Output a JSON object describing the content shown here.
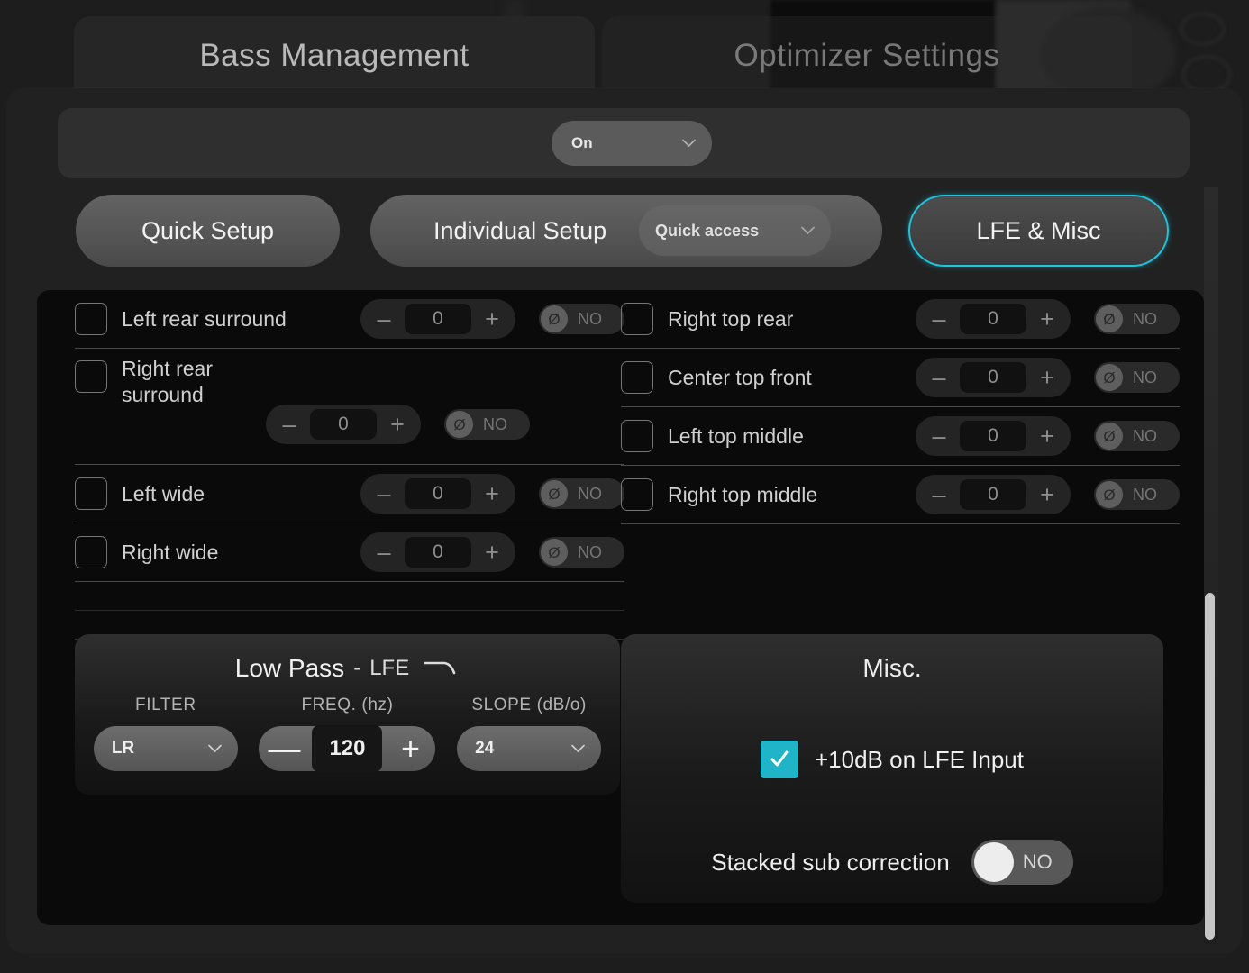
{
  "tabs": [
    {
      "label": "Bass Management",
      "active": true
    },
    {
      "label": "Optimizer Settings",
      "active": false
    }
  ],
  "power": {
    "value": "On",
    "icon": "chevron-down-icon"
  },
  "segments": [
    {
      "label": "Quick Setup",
      "active": false
    },
    {
      "label": "Individual Setup",
      "active": false
    },
    {
      "label": "LFE & Misc",
      "active": true
    }
  ],
  "quick_access": {
    "value": "Quick access",
    "icon": "chevron-down-icon"
  },
  "accent_color": "#21c3dd",
  "channels_left": [
    {
      "name": "Left rear surround",
      "checked": false,
      "level": "0",
      "phase": "NO",
      "wrapped": false
    },
    {
      "name": "Right rear surround",
      "checked": false,
      "level": "0",
      "phase": "NO",
      "wrapped": true
    },
    {
      "name": "Left wide",
      "checked": false,
      "level": "0",
      "phase": "NO",
      "wrapped": false
    },
    {
      "name": "Right wide",
      "checked": false,
      "level": "0",
      "phase": "NO",
      "wrapped": false
    }
  ],
  "channels_right": [
    {
      "name": "Right top rear",
      "checked": false,
      "level": "0",
      "phase": "NO",
      "wrapped": false
    },
    {
      "name": "Center top front",
      "checked": false,
      "level": "0",
      "phase": "NO",
      "wrapped": false
    },
    {
      "name": "Left top middle",
      "checked": false,
      "level": "0",
      "phase": "NO",
      "wrapped": false
    },
    {
      "name": "Right top middle",
      "checked": false,
      "level": "0",
      "phase": "NO",
      "wrapped": false
    }
  ],
  "stepper": {
    "minus": "–",
    "plus": "+"
  },
  "phase_glyph": "Ø",
  "lowpass": {
    "title_main": "Low Pass",
    "title_dash": "-",
    "title_sub": "LFE",
    "curve_icon": "lowpass-curve-icon",
    "filter_label": "FILTER",
    "filter_value": "LR",
    "freq_label": "FREQ. (hz)",
    "freq_value": "120",
    "freq_minus": "—",
    "freq_plus": "+",
    "slope_label": "SLOPE (dB/o)",
    "slope_value": "24"
  },
  "misc": {
    "title": "Misc.",
    "lfe_boost_label": "+10dB on LFE Input",
    "lfe_boost_checked": true,
    "stacked_sub_label": "Stacked sub correction",
    "stacked_sub_value": "NO"
  }
}
